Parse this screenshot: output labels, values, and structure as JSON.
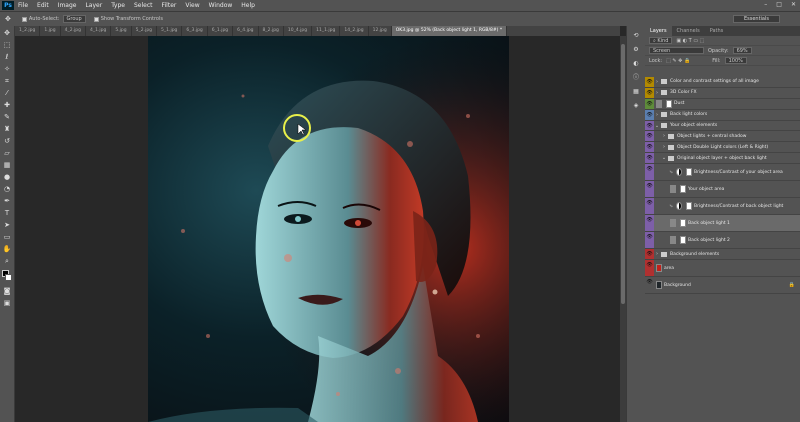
{
  "app": {
    "logo": "Ps"
  },
  "menu": [
    "File",
    "Edit",
    "Image",
    "Layer",
    "Type",
    "Select",
    "Filter",
    "View",
    "Window",
    "Help"
  ],
  "window_buttons": [
    "–",
    "□",
    "✕"
  ],
  "options": {
    "auto_select_label": "Auto-Select:",
    "auto_select_value": "Group",
    "transform_label": "Show Transform Controls",
    "workspace": "Essentials"
  },
  "doc_tabs": [
    "1_2.jpg",
    "1.jpg",
    "4_2.jpg",
    "4_1.jpg",
    "5.jpg",
    "5_2.jpg",
    "5_1.jpg",
    "6_3.jpg",
    "6_1.jpg",
    "6_4.jpg",
    "8_2.jpg",
    "10_4.jpg",
    "11_1.jpg",
    "14_2.jpg",
    "12.jpg",
    "OK3.jpg @ 52% (Back object light 1, RGB/8#) *"
  ],
  "panel_tabs": [
    "Layers",
    "Channels",
    "Paths"
  ],
  "layers_panel": {
    "filter_kind": "Kind",
    "blend_mode": "Screen",
    "opacity_label": "Opacity:",
    "opacity_value": "69%",
    "lock_label": "Lock:",
    "fill_label": "Fill:",
    "fill_value": "100%"
  },
  "layers": [
    {
      "name": "Color and contrast settings of all image",
      "color": "#b38a00",
      "type": "group",
      "indent": 0
    },
    {
      "name": "3D Color FX",
      "color": "#b38a00",
      "type": "group",
      "indent": 0
    },
    {
      "name": "Dust",
      "color": "#5e8c3a",
      "type": "layer-mask",
      "indent": 0
    },
    {
      "name": "Back light colors",
      "color": "#5b7fb0",
      "type": "group",
      "indent": 0
    },
    {
      "name": "Your object elements",
      "color": "#7d5fa8",
      "type": "group-open",
      "indent": 0
    },
    {
      "name": "Object lights + central shadow",
      "color": "#7d5fa8",
      "type": "group",
      "indent": 1
    },
    {
      "name": "Object Double Light colors (Left & Right)",
      "color": "#7d5fa8",
      "type": "group",
      "indent": 1
    },
    {
      "name": "Original object layer + object back light",
      "color": "#7d5fa8",
      "type": "group-open",
      "indent": 1
    },
    {
      "name": "Brightness/Contrast of your object area",
      "color": "#7d5fa8",
      "type": "adjust",
      "indent": 2,
      "tall": true
    },
    {
      "name": "Your object area",
      "color": "#7d5fa8",
      "type": "layer",
      "indent": 2,
      "tall": true
    },
    {
      "name": "Brightness/Contrast of back object light",
      "color": "#7d5fa8",
      "type": "adjust",
      "indent": 2,
      "tall": true
    },
    {
      "name": "Back object light 1",
      "color": "#7d5fa8",
      "type": "layer",
      "indent": 2,
      "tall": true,
      "selected": true
    },
    {
      "name": "Back object light 2",
      "color": "#7d5fa8",
      "type": "layer",
      "indent": 2,
      "tall": true
    },
    {
      "name": "Background elements",
      "color": "#b03030",
      "type": "group",
      "indent": 0
    },
    {
      "name": "area",
      "color": "#b03030",
      "type": "layer",
      "indent": 0,
      "tall": true
    },
    {
      "name": "Background",
      "color": "#535353",
      "type": "layer",
      "indent": 0,
      "tall": true
    }
  ]
}
